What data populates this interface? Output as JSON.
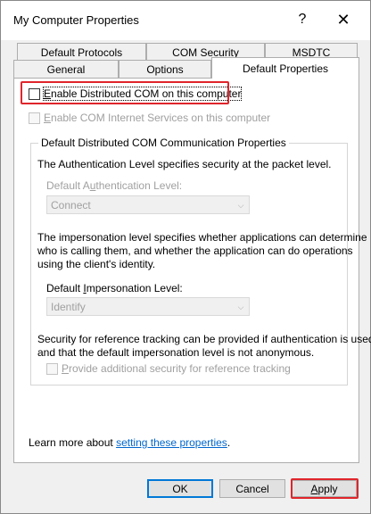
{
  "window": {
    "title": "My Computer Properties",
    "help_glyph": "?",
    "close_glyph": "✕"
  },
  "tabs": {
    "row1": [
      "Default Protocols",
      "COM Security",
      "MSDTC"
    ],
    "row2": [
      "General",
      "Options",
      "Default Properties"
    ],
    "active": "Default Properties"
  },
  "panel": {
    "enable_dcom": {
      "prefix": "",
      "accel": "E",
      "rest": "nable Distributed COM on this computer",
      "checked": false
    },
    "enable_cis": {
      "accel": "E",
      "rest": "nable COM Internet Services on this computer",
      "checked": false
    },
    "group_title": "Default Distributed COM Communication Properties",
    "auth_desc": "The Authentication Level specifies security at the packet level.",
    "auth_label": {
      "before": "Default A",
      "accel": "u",
      "after": "thentication Level:"
    },
    "auth_value": "Connect",
    "imp_desc_1": "The impersonation level specifies whether applications can determine",
    "imp_desc_2": "who is calling them, and whether the application can do operations",
    "imp_desc_3": "using the client's identity.",
    "imp_label": {
      "before": "Default ",
      "accel": "I",
      "after": "mpersonation Level:"
    },
    "imp_value": "Identify",
    "ref_desc_1": "Security for reference tracking can be provided if authentication is used",
    "ref_desc_2": "and that the default impersonation level is not anonymous.",
    "ref_checkbox": {
      "accel": "P",
      "rest": "rovide additional security for reference tracking",
      "checked": false
    },
    "learn_more_prefix": "Learn more about ",
    "learn_more_link": "setting these properties",
    "learn_more_suffix": "."
  },
  "buttons": {
    "ok": "OK",
    "cancel": "Cancel",
    "apply": {
      "accel": "A",
      "rest": "pply"
    }
  },
  "colors": {
    "highlight": "#e0252b",
    "link": "#0066cc",
    "default_button_border": "#0078d7"
  }
}
